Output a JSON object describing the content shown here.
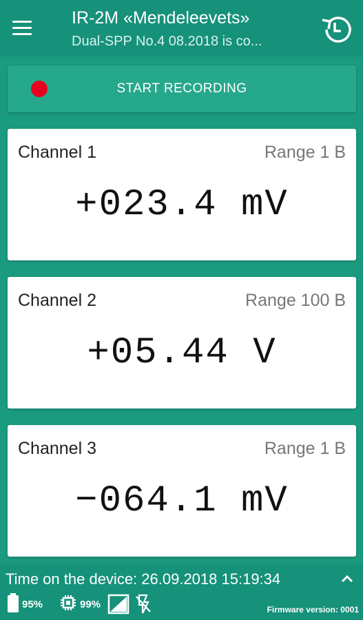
{
  "appbar": {
    "title": "IR-2M «Mendeleevets»",
    "subtitle": "Dual-SPP No.4 08.2018 is co...",
    "menu_icon": "hamburger-menu-icon",
    "history_icon": "history-icon"
  },
  "record": {
    "label": "START RECORDING",
    "dot_color": "#e8001e"
  },
  "channels": [
    {
      "name": "Channel 1",
      "range": "Range 1 B",
      "value": "+023.4 mV"
    },
    {
      "name": "Channel 2",
      "range": "Range 100 B",
      "value": "+05.44 V"
    },
    {
      "name": "Channel 3",
      "range": "Range 1 B",
      "value": "−064.1 mV"
    }
  ],
  "footer": {
    "time_label": "Time on the device: 26.09.2018 15:19:34",
    "battery": "95%",
    "cpu": "99%",
    "firmware": "Firmware version: 0001",
    "icons": [
      "battery-icon",
      "chip-icon",
      "signal-icon",
      "flash-off-icon",
      "chevron-up-icon"
    ]
  },
  "colors": {
    "primary": "#16917a",
    "background": "#1a9a7e",
    "button": "#26a88c"
  }
}
